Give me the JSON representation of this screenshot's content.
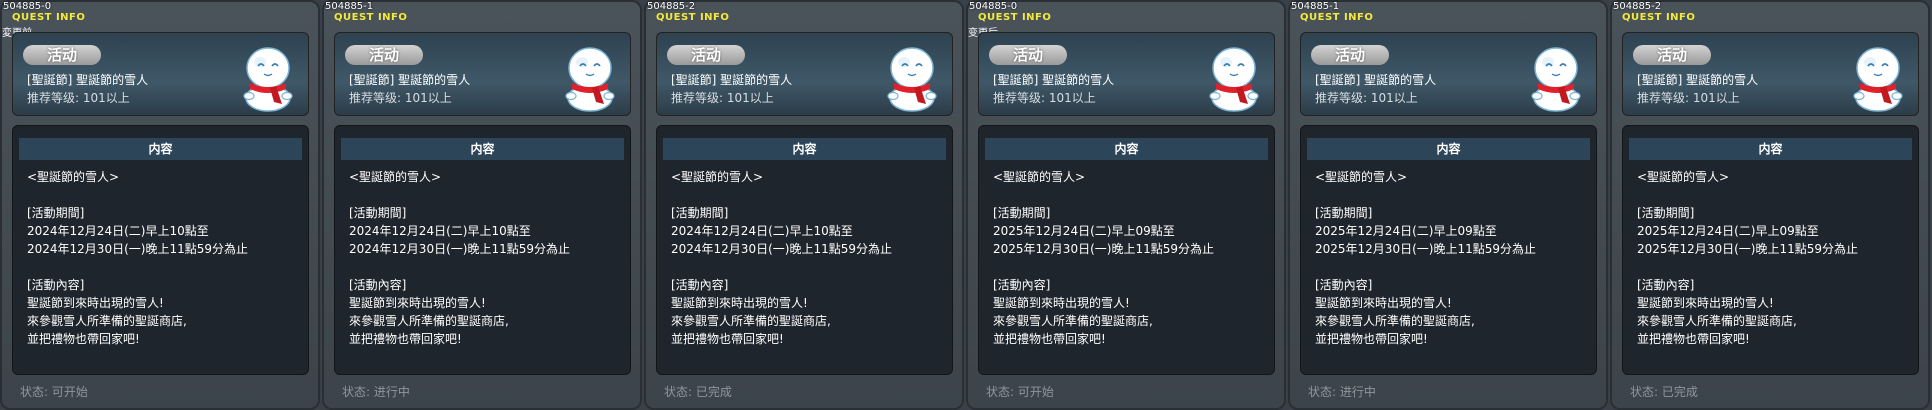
{
  "panels": [
    {
      "id": "504885-0",
      "title": "QUEST INFO",
      "before_change": "変更前",
      "type_label": "活动",
      "name": "[聖誕節] 聖誕節的雪人",
      "level": "推荐等级: 101以上",
      "content_header": "内容",
      "content": {
        "subtitle": "<聖誕節的雪人>",
        "period_head": "[活動期間]",
        "period_start": "2024年12月24日(二)早上10點至",
        "period_end": "2024年12月30日(一)晚上11點59分為止",
        "desc_head": "[活動內容]",
        "desc_1": "聖誕節到來時出現的雪人!",
        "desc_2": "來參觀雪人所準備的聖誕商店,",
        "desc_3": "並把禮物也帶回家吧!"
      },
      "status": "状态: 可开始"
    },
    {
      "id": "504885-1",
      "title": "QUEST INFO",
      "before_change": "",
      "type_label": "活动",
      "name": "[聖誕節] 聖誕節的雪人",
      "level": "推荐等级: 101以上",
      "content_header": "内容",
      "content": {
        "subtitle": "<聖誕節的雪人>",
        "period_head": "[活動期間]",
        "period_start": "2024年12月24日(二)早上10點至",
        "period_end": "2024年12月30日(一)晚上11點59分為止",
        "desc_head": "[活動內容]",
        "desc_1": "聖誕節到來時出現的雪人!",
        "desc_2": "來參觀雪人所準備的聖誕商店,",
        "desc_3": "並把禮物也帶回家吧!"
      },
      "status": "状态: 进行中"
    },
    {
      "id": "504885-2",
      "title": "QUEST INFO",
      "before_change": "",
      "type_label": "活动",
      "name": "[聖誕節] 聖誕節的雪人",
      "level": "推荐等级: 101以上",
      "content_header": "内容",
      "content": {
        "subtitle": "<聖誕節的雪人>",
        "period_head": "[活動期間]",
        "period_start": "2024年12月24日(二)早上10點至",
        "period_end": "2024年12月30日(一)晚上11點59分為止",
        "desc_head": "[活動內容]",
        "desc_1": "聖誕節到來時出現的雪人!",
        "desc_2": "來參觀雪人所準備的聖誕商店,",
        "desc_3": "並把禮物也帶回家吧!"
      },
      "status": "状态: 已完成"
    },
    {
      "id": "504885-0",
      "title": "QUEST INFO",
      "before_change": "变更后",
      "type_label": "活动",
      "name": "[聖誕節] 聖誕節的雪人",
      "level": "推荐等级: 101以上",
      "content_header": "内容",
      "content": {
        "subtitle": "<聖誕節的雪人>",
        "period_head": "[活動期間]",
        "period_start": "2025年12月24日(二)早上09點至",
        "period_end": "2025年12月30日(一)晚上11點59分為止",
        "desc_head": "[活動內容]",
        "desc_1": "聖誕節到來時出現的雪人!",
        "desc_2": "來參觀雪人所準備的聖誕商店,",
        "desc_3": "並把禮物也帶回家吧!"
      },
      "status": "状态: 可开始"
    },
    {
      "id": "504885-1",
      "title": "QUEST INFO",
      "before_change": "",
      "type_label": "活动",
      "name": "[聖誕節] 聖誕節的雪人",
      "level": "推荐等级: 101以上",
      "content_header": "内容",
      "content": {
        "subtitle": "<聖誕節的雪人>",
        "period_head": "[活動期間]",
        "period_start": "2025年12月24日(二)早上09點至",
        "period_end": "2025年12月30日(一)晚上11點59分為止",
        "desc_head": "[活動內容]",
        "desc_1": "聖誕節到來時出現的雪人!",
        "desc_2": "來參觀雪人所準備的聖誕商店,",
        "desc_3": "並把禮物也帶回家吧!"
      },
      "status": "状态: 进行中"
    },
    {
      "id": "504885-2",
      "title": "QUEST INFO",
      "before_change": "",
      "type_label": "活动",
      "name": "[聖誕節] 聖誕節的雪人",
      "level": "推荐等级: 101以上",
      "content_header": "内容",
      "content": {
        "subtitle": "<聖誕節的雪人>",
        "period_head": "[活動期間]",
        "period_start": "2025年12月24日(二)早上09點至",
        "period_end": "2025年12月30日(一)晚上11點59分為止",
        "desc_head": "[活動內容]",
        "desc_1": "聖誕節到來時出現的雪人!",
        "desc_2": "來參觀雪人所準備的聖誕商店,",
        "desc_3": "並把禮物也帶回家吧!"
      },
      "status": "状态: 已完成"
    }
  ],
  "icons": {
    "quest_npc": "snowman-icon"
  },
  "colors": {
    "title_yellow": "#f2ea3c",
    "badge_gray": "#b5b5b5",
    "content_header_blue": "#2c4558",
    "scarf_red": "#e0202a",
    "status_gray": "#8f969c"
  }
}
